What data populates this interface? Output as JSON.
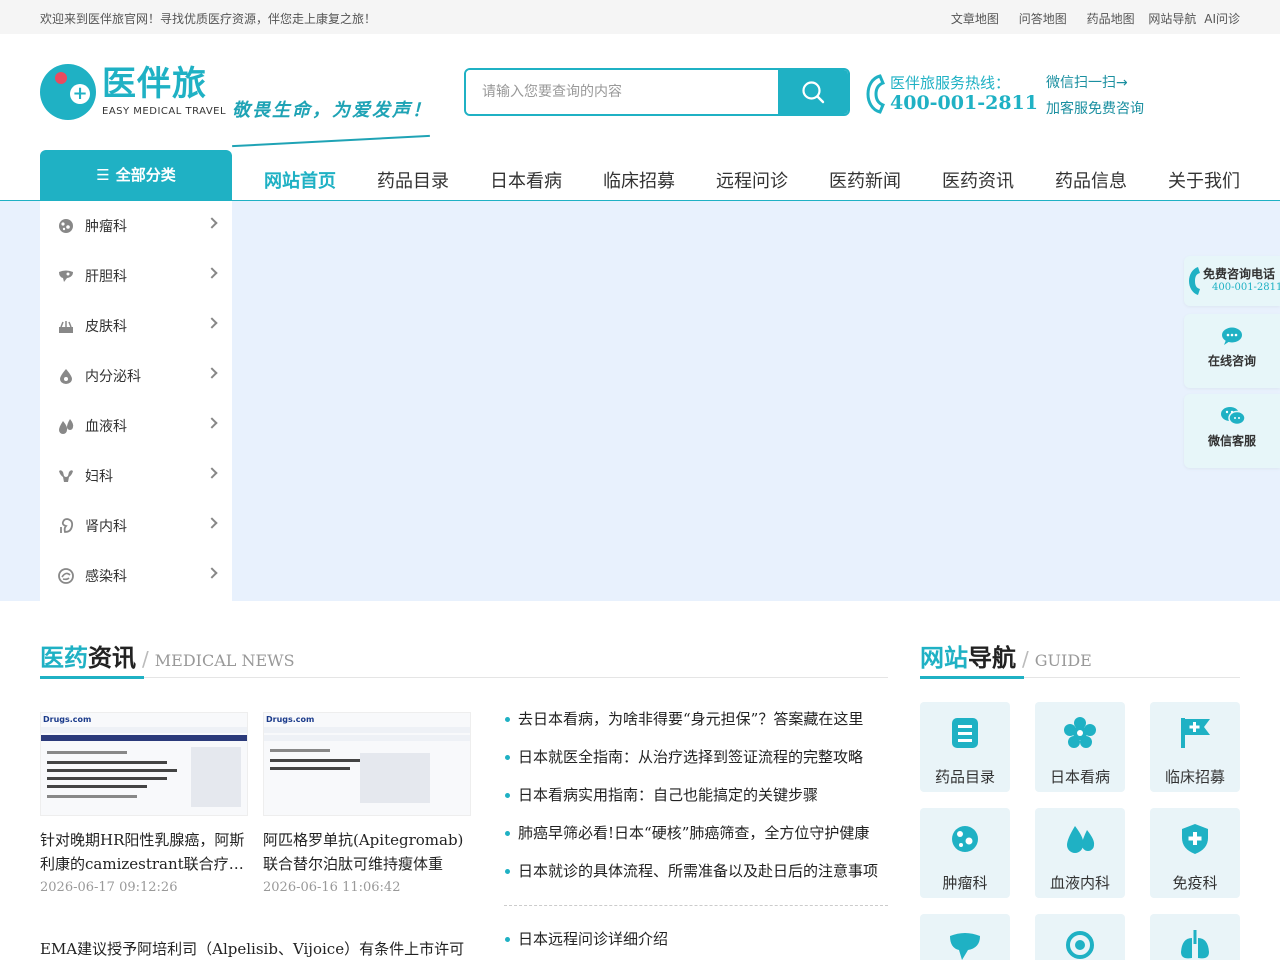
{
  "topbar": {
    "welcome": "欢迎来到医伴旅官网！寻找优质医疗资源，伴您走上康复之旅！",
    "links": [
      "文章地图",
      "问答地图",
      "药品地图",
      "网站导航",
      "AI问诊"
    ]
  },
  "brand": {
    "name": "医伴旅",
    "en": "EASY MEDICAL TRAVEL",
    "slogan": "敬畏生命，为爱发声！",
    "colors": {
      "primary": "#1fb1c4",
      "accent": "#e84b5f"
    }
  },
  "search": {
    "placeholder": "请输入您要查询的内容"
  },
  "hotline": {
    "label": "医伴旅服务热线：",
    "number": "400-001-2811"
  },
  "wechat": {
    "line1": "微信扫一扫→",
    "line2": "加客服免费咨询"
  },
  "nav": {
    "all_label": "全部分类",
    "items": [
      "网站首页",
      "药品目录",
      "日本看病",
      "临床招募",
      "远程问诊",
      "医药新闻",
      "医药资讯",
      "药品信息",
      "关于我们"
    ]
  },
  "categories": [
    "肿瘤科",
    "肝胆科",
    "皮肤科",
    "内分泌科",
    "血液科",
    "妇科",
    "肾内科",
    "感染科"
  ],
  "float": {
    "phone_title": "免费咨询电话",
    "phone_number": "400-001-2811",
    "online": "在线咨询",
    "wechat": "微信客服"
  },
  "news_section": {
    "title_a": "医药",
    "title_b": "资讯",
    "en": "MEDICAL NEWS"
  },
  "guide_section": {
    "title_a": "网站",
    "title_b": "导航",
    "en": "GUIDE"
  },
  "news_cards": [
    {
      "title": "针对晚期HR阳性乳腺癌，阿斯利康的camizestrant联合疗法获批",
      "date": "2026-06-17 09:12:26",
      "thumb_brand": "Drugs.com"
    },
    {
      "title": "阿匹格罗单抗(Apitegromab)联合替尔泊肽可维持瘦体重",
      "date": "2026-06-16 11:06:42",
      "thumb_brand": "Drugs.com"
    }
  ],
  "news_wide": "EMA建议授予阿培利司（Alpelisib、Vijoice）有条件上市许可",
  "news_list": [
    "去日本看病，为啥非得要“身元担保”？答案藏在这里",
    "日本就医全指南：从治疗选择到签证流程的完整攻略",
    "日本看病实用指南：自己也能搞定的关键步骤",
    "肺癌早筛必看!日本“硬核”肺癌筛查，全方位守护健康",
    "日本就诊的具体流程、所需准备以及赴日后的注意事项"
  ],
  "news_list2": [
    "日本远程问诊详细介绍"
  ],
  "guide": [
    {
      "label": "药品目录",
      "icon": "list-icon"
    },
    {
      "label": "日本看病",
      "icon": "sakura-icon"
    },
    {
      "label": "临床招募",
      "icon": "flag-plus-icon"
    },
    {
      "label": "肿瘤科",
      "icon": "cell-icon"
    },
    {
      "label": "血液内科",
      "icon": "blood-drop-icon"
    },
    {
      "label": "免疫科",
      "icon": "shield-plus-icon"
    },
    {
      "label": "",
      "icon": "liver-icon"
    },
    {
      "label": "",
      "icon": "ring-icon"
    },
    {
      "label": "",
      "icon": "lungs-icon"
    }
  ]
}
